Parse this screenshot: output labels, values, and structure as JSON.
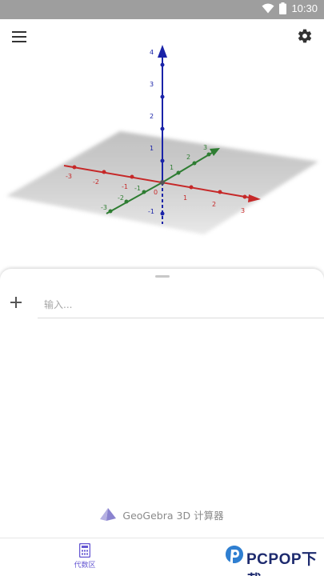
{
  "status_bar": {
    "time": "10:30"
  },
  "graphics_view": {
    "axes": {
      "x": {
        "color": "#c62828",
        "ticks": [
          "-3",
          "-2",
          "-1",
          "0",
          "1",
          "2",
          "3"
        ]
      },
      "y": {
        "color": "#2e7d32",
        "ticks": [
          "-3",
          "-2",
          "-1",
          "1",
          "2",
          "3"
        ]
      },
      "z": {
        "color": "#1a23a8",
        "ticks": [
          "-1",
          "1",
          "2",
          "3",
          "4"
        ]
      }
    }
  },
  "algebra_view": {
    "input_placeholder": "输入...",
    "brand_text": "GeoGebra 3D 计算器"
  },
  "bottom_nav": {
    "items": [
      {
        "label": "代数区",
        "icon": "calculator-icon",
        "color": "#6557d2"
      }
    ]
  },
  "watermark": {
    "text": "PCPOP下载"
  },
  "colors": {
    "accent": "#6557d2",
    "status_bar": "#9e9e9e"
  }
}
